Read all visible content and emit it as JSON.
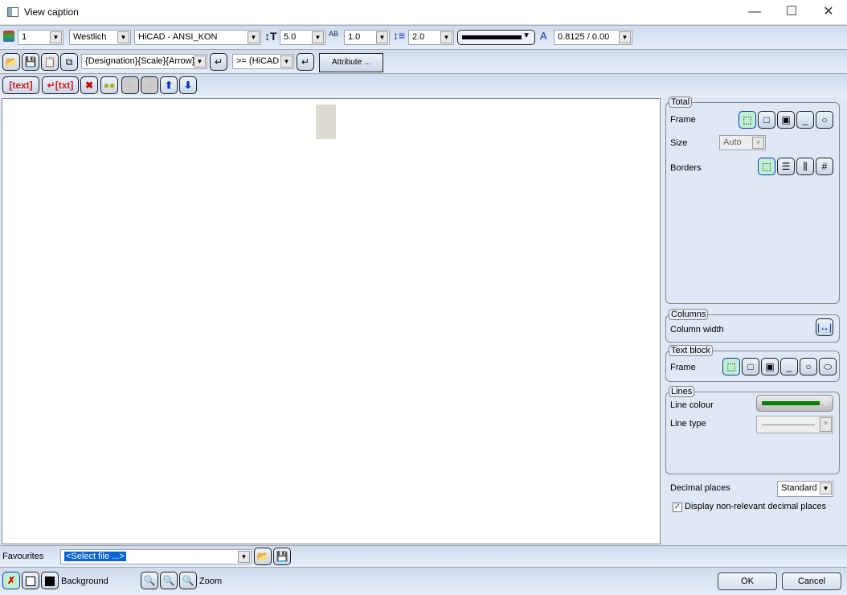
{
  "window": {
    "title": "View caption",
    "minimize": "—",
    "maximize": "☐",
    "close": "✕"
  },
  "toolbar1": {
    "layer": "1",
    "font": "Westlich",
    "standard": "HiCAD - ANSI_KON",
    "text_height": "5.0",
    "char_spacing": "1.0",
    "line_spacing": "2.0",
    "text_ratio": "0.8125 / 0.00"
  },
  "toolbar2": {
    "template": "{Designation}{Scale}{Arrow}",
    "filter": ">= (HiCAD",
    "attribute_label": "Attribute ...",
    "insert_arrow": "↵"
  },
  "toolbar3": {
    "text_label": "[text]",
    "newline_text_label": "↵[txt]"
  },
  "panel": {
    "total": {
      "title": "Total",
      "frame_label": "Frame",
      "size_label": "Size",
      "size_value": "Auto",
      "borders_label": "Borders"
    },
    "columns": {
      "title": "Columns",
      "width_label": "Column width"
    },
    "text_block": {
      "title": "Text block",
      "frame_label": "Frame"
    },
    "lines": {
      "title": "Lines",
      "colour_label": "Line colour",
      "type_label": "Line type",
      "colour": "#008000"
    },
    "decimal_label": "Decimal places",
    "decimal_value": "Standard",
    "display_nonrelevant_label": "Display non-relevant decimal places",
    "display_nonrelevant_checked": true
  },
  "favourites": {
    "label": "Favourites",
    "value": "<Select file ...>"
  },
  "bottom": {
    "background_label": "Background",
    "zoom_label": "Zoom",
    "ok": "OK",
    "cancel": "Cancel"
  }
}
